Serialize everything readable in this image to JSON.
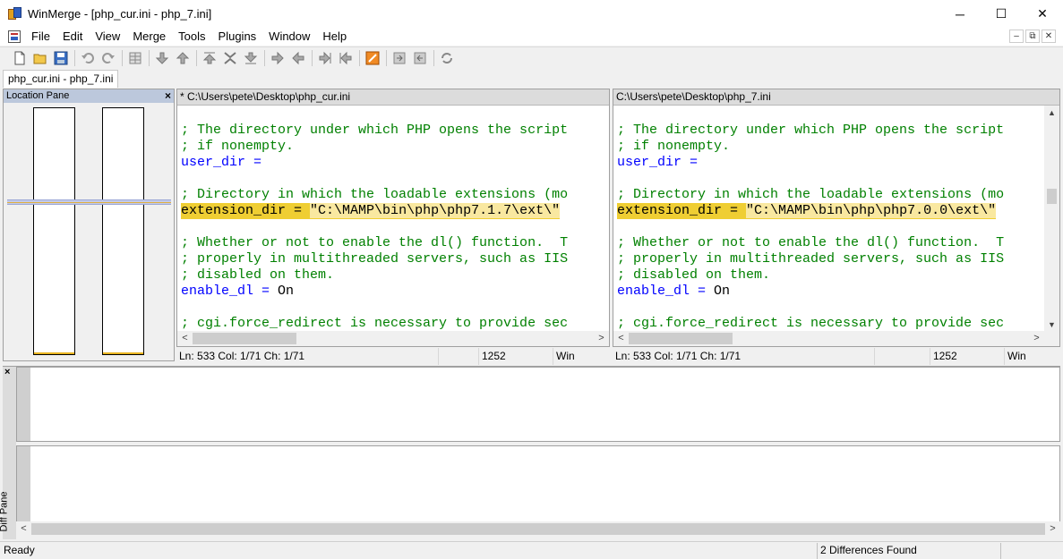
{
  "window": {
    "title": "WinMerge - [php_cur.ini - php_7.ini]",
    "minimize": "─",
    "maximize": "☐",
    "close": "✕"
  },
  "menu": [
    "File",
    "Edit",
    "View",
    "Merge",
    "Tools",
    "Plugins",
    "Window",
    "Help"
  ],
  "mdi": {
    "minimize": "–",
    "restore": "⧉",
    "close": "✕"
  },
  "toolbar": {
    "icons": [
      "new-icon",
      "open-icon",
      "save-icon",
      "undo-icon",
      "redo-icon",
      "options-icon",
      "next-diff-icon",
      "prev-diff-icon",
      "first-diff-icon",
      "current-diff-icon",
      "last-diff-icon",
      "copy-right-icon",
      "copy-left-icon",
      "copy-right-advance-icon",
      "copy-left-advance-icon",
      "all-left-icon",
      "all-right-icon",
      "refresh-icon",
      "edit-icon"
    ]
  },
  "tab": {
    "label": "php_cur.ini - php_7.ini"
  },
  "location_pane": {
    "title": "Location Pane",
    "close": "×"
  },
  "left_pane": {
    "path": "* C:\\Users\\pete\\Desktop\\php_cur.ini",
    "lines": [
      {
        "type": "comment",
        "text": "; The directory under which PHP opens the script"
      },
      {
        "type": "comment",
        "text": "; if nonempty."
      },
      {
        "type": "kv",
        "key": "user_dir",
        "op": " =",
        "val": ""
      },
      {
        "type": "blank",
        "text": ""
      },
      {
        "type": "comment",
        "text": "; Directory in which the loadable extensions (mo"
      },
      {
        "type": "diff",
        "key": "extension_dir",
        "op": " = ",
        "val": "\"C:\\MAMP\\bin\\php\\php7.1.7\\ext\\\""
      },
      {
        "type": "blank",
        "text": ""
      },
      {
        "type": "comment",
        "text": "; Whether or not to enable the dl() function.  T"
      },
      {
        "type": "comment",
        "text": "; properly in multithreaded servers, such as IIS"
      },
      {
        "type": "comment",
        "text": "; disabled on them."
      },
      {
        "type": "kv",
        "key": "enable_dl",
        "op": " = ",
        "val": "On"
      },
      {
        "type": "blank",
        "text": ""
      },
      {
        "type": "comment",
        "text": "; cgi.force_redirect is necessary to provide sec"
      }
    ],
    "status": {
      "pos": "Ln: 533  Col: 1/71  Ch: 1/71",
      "blank": "",
      "num": "1252",
      "eol": "Win"
    }
  },
  "right_pane": {
    "path": "C:\\Users\\pete\\Desktop\\php_7.ini",
    "lines": [
      {
        "type": "comment",
        "text": "; The directory under which PHP opens the script"
      },
      {
        "type": "comment",
        "text": "; if nonempty."
      },
      {
        "type": "kv",
        "key": "user_dir",
        "op": " =",
        "val": ""
      },
      {
        "type": "blank",
        "text": ""
      },
      {
        "type": "comment",
        "text": "; Directory in which the loadable extensions (mo"
      },
      {
        "type": "diff",
        "key": "extension_dir",
        "op": " = ",
        "val": "\"C:\\MAMP\\bin\\php\\php7.0.0\\ext\\\""
      },
      {
        "type": "blank",
        "text": ""
      },
      {
        "type": "comment",
        "text": "; Whether or not to enable the dl() function.  T"
      },
      {
        "type": "comment",
        "text": "; properly in multithreaded servers, such as IIS"
      },
      {
        "type": "comment",
        "text": "; disabled on them."
      },
      {
        "type": "kv",
        "key": "enable_dl",
        "op": " = ",
        "val": "On"
      },
      {
        "type": "blank",
        "text": ""
      },
      {
        "type": "comment",
        "text": "; cgi.force_redirect is necessary to provide sec"
      }
    ],
    "status": {
      "pos": "Ln: 533  Col: 1/71  Ch: 1/71",
      "blank": "",
      "num": "1252",
      "eol": "Win"
    }
  },
  "scroll": {
    "left": "<",
    "right": ">",
    "up": "▲",
    "down": "▼"
  },
  "diff_pane": {
    "label": "Diff Pane",
    "close": "×"
  },
  "statusbar": {
    "ready": "Ready",
    "diffs": "2 Differences Found"
  }
}
